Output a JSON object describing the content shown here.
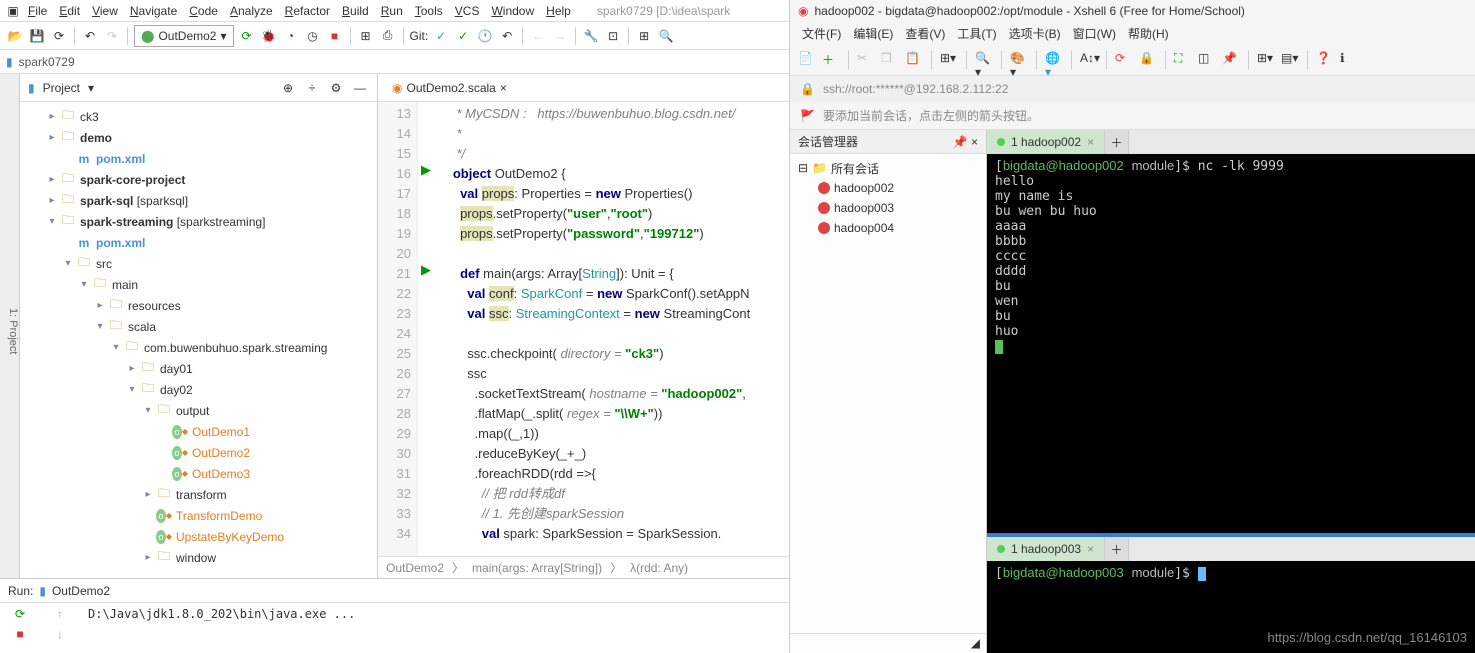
{
  "ij": {
    "menus": [
      "File",
      "Edit",
      "View",
      "Navigate",
      "Code",
      "Analyze",
      "Refactor",
      "Build",
      "Run",
      "Tools",
      "VCS",
      "Window",
      "Help"
    ],
    "title": "spark0729 [D:\\idea\\spark",
    "runConfig": "OutDemo2",
    "gitLabel": "Git:",
    "crumb": "spark0729",
    "project": {
      "label": "Project"
    },
    "tree": [
      {
        "d": 1,
        "c": "▸",
        "i": "folder",
        "t": "ck3"
      },
      {
        "d": 1,
        "c": "▸",
        "i": "folder",
        "t": "demo",
        "b": true
      },
      {
        "d": 2,
        "c": "",
        "i": "m",
        "t": "pom.xml",
        "cls": "file-m"
      },
      {
        "d": 1,
        "c": "▸",
        "i": "folder",
        "t": "spark-core-project",
        "b": true
      },
      {
        "d": 1,
        "c": "▸",
        "i": "folder",
        "t": "spark-sql [sparksql]"
      },
      {
        "d": 1,
        "c": "▾",
        "i": "folder",
        "t": "spark-streaming [sparkstreaming]",
        "b": true
      },
      {
        "d": 2,
        "c": "",
        "i": "m",
        "t": "pom.xml",
        "cls": "file-m"
      },
      {
        "d": 2,
        "c": "▾",
        "i": "folder",
        "t": "src"
      },
      {
        "d": 3,
        "c": "▾",
        "i": "folder",
        "t": "main"
      },
      {
        "d": 4,
        "c": "▸",
        "i": "folder",
        "t": "resources"
      },
      {
        "d": 4,
        "c": "▾",
        "i": "folder",
        "t": "scala"
      },
      {
        "d": 5,
        "c": "▾",
        "i": "folder",
        "t": "com.buwenbuhuo.spark.streaming"
      },
      {
        "d": 6,
        "c": "▸",
        "i": "folder",
        "t": "day01"
      },
      {
        "d": 6,
        "c": "▾",
        "i": "folder",
        "t": "day02"
      },
      {
        "d": 7,
        "c": "▾",
        "i": "folder",
        "t": "output"
      },
      {
        "d": 8,
        "c": "",
        "i": "o",
        "t": "OutDemo1",
        "cls": "file-o"
      },
      {
        "d": 8,
        "c": "",
        "i": "o",
        "t": "OutDemo2",
        "cls": "file-o"
      },
      {
        "d": 8,
        "c": "",
        "i": "o",
        "t": "OutDemo3",
        "cls": "file-o"
      },
      {
        "d": 7,
        "c": "▸",
        "i": "folder",
        "t": "transform"
      },
      {
        "d": 7,
        "c": "",
        "i": "o",
        "t": "TransformDemo",
        "cls": "file-o"
      },
      {
        "d": 7,
        "c": "",
        "i": "o",
        "t": "UpstateByKeyDemo",
        "cls": "file-o"
      },
      {
        "d": 7,
        "c": "▸",
        "i": "folder",
        "t": "window"
      }
    ],
    "tabName": "OutDemo2.scala",
    "lines": [
      13,
      14,
      15,
      16,
      17,
      18,
      19,
      20,
      21,
      22,
      23,
      24,
      25,
      26,
      27,
      28,
      29,
      30,
      31,
      32,
      33,
      34
    ],
    "runMarks": {
      "16": true,
      "21": true
    },
    "code": {
      "13": {
        "html": "    <span class='cmt'>* MyCSDN :   https://buwenbuhuo.blog.csdn.net/</span>"
      },
      "14": {
        "html": "    <span class='cmt'>*</span>"
      },
      "15": {
        "html": "    <span class='cmt'>*/</span>"
      },
      "16": {
        "html": "   <span class='kw'>object</span> OutDemo2 {"
      },
      "17": {
        "html": "     <span class='kw'>val</span> <span class='hl'>props</span>: Properties = <span class='kw'>new</span> Properties()"
      },
      "18": {
        "html": "     <span class='hl'>props</span>.setProperty(<span class='str'>\"user\"</span>,<span class='str'>\"root\"</span>)"
      },
      "19": {
        "html": "     <span class='hl'>props</span>.setProperty(<span class='str'>\"password\"</span>,<span class='str'>\"199712\"</span>)"
      },
      "20": {
        "html": ""
      },
      "21": {
        "html": "     <span class='kw'>def</span> main(args: Array[<span class='type'>String</span>]): Unit = {"
      },
      "22": {
        "html": "       <span class='kw'>val</span> <span class='hl'>conf</span>: <span class='type'>SparkConf</span> = <span class='kw'>new</span> SparkConf().setAppN"
      },
      "23": {
        "html": "       <span class='kw'>val</span> <span class='hl'>ssc</span>: <span class='type'>StreamingContext</span> = <span class='kw'>new</span> StreamingCont"
      },
      "24": {
        "html": ""
      },
      "25": {
        "html": "       ssc.checkpoint( <span class='cmt'>directory = </span><span class='str'>\"ck3\"</span>)"
      },
      "26": {
        "html": "       ssc"
      },
      "27": {
        "html": "         .socketTextStream( <span class='cmt'>hostname = </span><span class='str'>\"hadoop002\"</span>,"
      },
      "28": {
        "html": "         .flatMap(_.split( <span class='cmt'>regex = </span><span class='str'>\"\\\\W+\"</span>))"
      },
      "29": {
        "html": "         .map((_,1))"
      },
      "30": {
        "html": "         .reduceByKey(_+_)"
      },
      "31": {
        "html": "         .foreachRDD(rdd =&gt;{"
      },
      "32": {
        "html": "           <span class='cmt'>// 把 rdd转成df</span>"
      },
      "33": {
        "html": "           <span class='cmt'>// 1. 先创建sparkSession</span>"
      },
      "34": {
        "html": "           <span class='kw'>val</span> spark: SparkSession = SparkSession."
      }
    },
    "breadcrumb": [
      "OutDemo2",
      "main(args: Array[String])",
      "λ(rdd: Any)"
    ],
    "run": {
      "label": "Run:",
      "tab": "OutDemo2",
      "out": "D:\\Java\\jdk1.8.0_202\\bin\\java.exe ..."
    }
  },
  "xs": {
    "title": "hadoop002 - bigdata@hadoop002:/opt/module - Xshell 6 (Free for Home/School)",
    "menus": [
      "文件(F)",
      "编辑(E)",
      "查看(V)",
      "工具(T)",
      "选项卡(B)",
      "窗口(W)",
      "帮助(H)"
    ],
    "addr": "ssh://root:******@192.168.2.112:22",
    "hint": "要添加当前会话，点击左侧的箭头按钮。",
    "sessHead": "会话管理器",
    "sessRoot": "所有会话",
    "sessions": [
      "hadoop002",
      "hadoop003",
      "hadoop004"
    ],
    "tab1": "1 hadoop002",
    "term1": "[bigdata@hadoop002 module]$ nc -lk 9999\nhello\nmy name is\nbu wen bu huo\naaaa\nbbbb\ncccc\ndddd\nbu\nwen\nbu\nhuo",
    "tab2": "1 hadoop003",
    "term2": "[bigdata@hadoop003 module]$ ",
    "watermark": "https://blog.csdn.net/qq_16146103"
  }
}
